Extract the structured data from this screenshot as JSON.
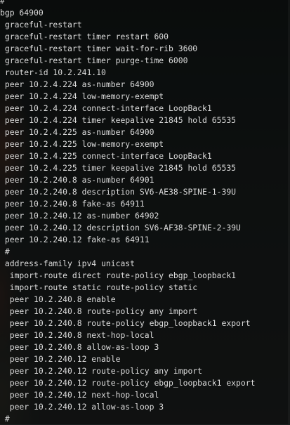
{
  "terminal": {
    "lines": [
      "#",
      "bgp 64900",
      " graceful-restart",
      " graceful-restart timer restart 600",
      " graceful-restart timer wait-for-rib 3600",
      " graceful-restart timer purge-time 6000",
      " router-id 10.2.241.10",
      " peer 10.2.4.224 as-number 64900",
      " peer 10.2.4.224 low-memory-exempt",
      " peer 10.2.4.224 connect-interface LoopBack1",
      " peer 10.2.4.224 timer keepalive 21845 hold 65535",
      " peer 10.2.4.225 as-number 64900",
      " peer 10.2.4.225 low-memory-exempt",
      " peer 10.2.4.225 connect-interface LoopBack1",
      " peer 10.2.4.225 timer keepalive 21845 hold 65535",
      " peer 10.2.240.8 as-number 64901",
      " peer 10.2.240.8 description SV6-AE38-SPINE-1-39U",
      " peer 10.2.240.8 fake-as 64911",
      " peer 10.2.240.12 as-number 64902",
      " peer 10.2.240.12 description SV6-AF38-SPINE-2-39U",
      " peer 10.2.240.12 fake-as 64911",
      " #",
      " address-family ipv4 unicast",
      "  import-route direct route-policy ebgp_loopback1",
      "  import-route static route-policy static",
      "  peer 10.2.240.8 enable",
      "  peer 10.2.240.8 route-policy any import",
      "  peer 10.2.240.8 route-policy ebgp_loopback1 export",
      "  peer 10.2.240.8 next-hop-local",
      "  peer 10.2.240.8 allow-as-loop 3",
      "  peer 10.2.240.12 enable",
      "  peer 10.2.240.12 route-policy any import",
      "  peer 10.2.240.12 route-policy ebgp_loopback1 export",
      "  peer 10.2.240.12 next-hop-local",
      "  peer 10.2.240.12 allow-as-loop 3",
      " #"
    ]
  },
  "colors": {
    "text": "#dcdcdc",
    "background": "#0a0c0c"
  }
}
